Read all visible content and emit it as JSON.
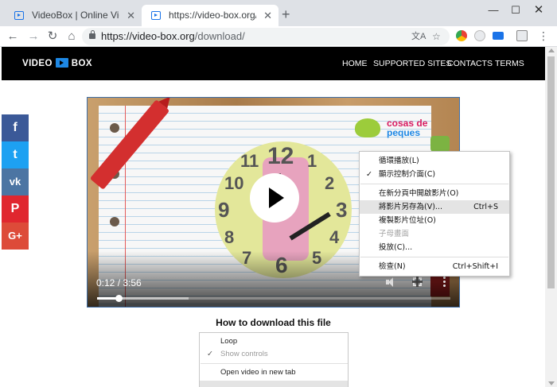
{
  "browser": {
    "tabs": [
      {
        "title": "VideoBox | Online Video Conve",
        "close": "✕"
      },
      {
        "title": "https://video-box.org/downlo",
        "close": "✕"
      }
    ],
    "new_tab": "+",
    "window_controls": {
      "minimize": "—",
      "maximize": "☐",
      "close": "✕"
    },
    "url_host": "https://video-box.org",
    "url_path": "/download/",
    "nav_icons": {
      "back": "←",
      "forward": "→",
      "reload": "↻",
      "home": "⌂",
      "translate": "文A",
      "star": "☆",
      "menu": "⋮"
    }
  },
  "site": {
    "logo_left": "VIDEO",
    "logo_right": "BOX",
    "nav": [
      "HOME",
      "SUPPORTED SITES",
      "CONTACTS",
      "TERMS"
    ],
    "social": [
      "f",
      "t",
      "vk",
      "P",
      "G+"
    ],
    "social_colors": {
      "facebook": "#3b5998",
      "twitter": "#1da1f2",
      "vk": "#4c75a3",
      "pinterest": "#e0272f",
      "googleplus": "#dd4b39"
    }
  },
  "video": {
    "brand_top": "cosas de",
    "brand_bottom": "peques",
    "clock_numbers": [
      "12",
      "1",
      "2",
      "3",
      "4",
      "5",
      "6",
      "7",
      "8",
      "9",
      "10",
      "11"
    ],
    "current_time": "0:12 / 3:56",
    "progress_played": 0.06,
    "progress_buffered": 0.26
  },
  "context_menu": [
    {
      "label": "循環播放(L)",
      "checked": false,
      "shortcut": ""
    },
    {
      "label": "顯示控制介面(C)",
      "checked": true,
      "shortcut": ""
    },
    {
      "label": "在新分頁中開啟影片(O)",
      "checked": false,
      "shortcut": ""
    },
    {
      "label": "將影片另存為(V)...",
      "checked": false,
      "shortcut": "Ctrl+S",
      "highlight": true
    },
    {
      "label": "複製影片位址(O)",
      "checked": false,
      "shortcut": ""
    },
    {
      "label": "子母畫面",
      "checked": false,
      "shortcut": "",
      "disabled": true
    },
    {
      "label": "投放(C)...",
      "checked": false,
      "shortcut": ""
    },
    {
      "label": "檢查(N)",
      "checked": false,
      "shortcut": "Ctrl+Shift+I"
    }
  ],
  "howto_title": "How to download this file",
  "instruction_menu": [
    {
      "label": "Loop",
      "checked": false
    },
    {
      "label": "Show controls",
      "checked": true,
      "disabled": true
    },
    {
      "label": "Open video in new tab",
      "checked": false
    }
  ]
}
